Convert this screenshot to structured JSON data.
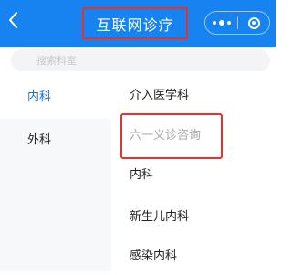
{
  "header": {
    "back_icon": "chevron-left-icon",
    "title": "互联网诊疗",
    "background": "#1783f0",
    "more_icon": "more-dots-icon",
    "close_icon": "close-target-icon"
  },
  "search": {
    "placeholder": "搜索科室"
  },
  "sidebar": {
    "items": [
      {
        "label": "内科",
        "active": true
      },
      {
        "label": "外科",
        "active": false
      }
    ],
    "active_color": "#1a6ed8"
  },
  "departments": [
    {
      "label": "介入医学科",
      "disabled": false
    },
    {
      "label": "六一义诊咨询",
      "disabled": true
    },
    {
      "label": "内科",
      "disabled": false
    },
    {
      "label": "新生儿内科",
      "disabled": false
    },
    {
      "label": "感染内科",
      "disabled": false
    }
  ],
  "highlight_color": "#e5322d"
}
